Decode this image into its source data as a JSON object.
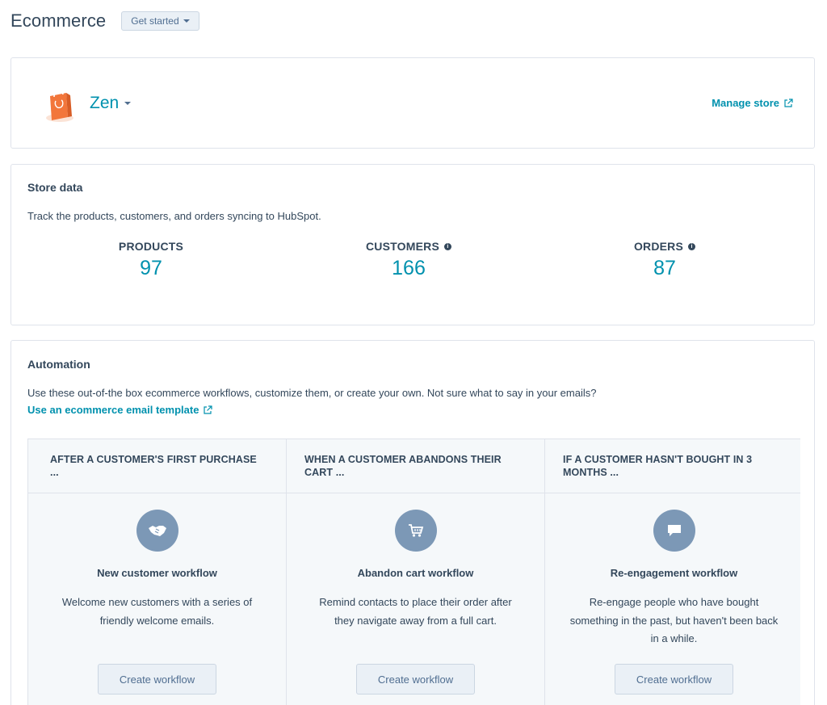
{
  "header": {
    "title": "Ecommerce",
    "get_started_label": "Get started"
  },
  "store": {
    "name": "Zen",
    "logo": "shopping-bag-logo",
    "manage_label": "Manage store"
  },
  "store_data": {
    "title": "Store data",
    "description": "Track the products, customers, and orders syncing to HubSpot.",
    "stats": [
      {
        "label": "PRODUCTS",
        "value": "97",
        "info": false
      },
      {
        "label": "CUSTOMERS",
        "value": "166",
        "info": true
      },
      {
        "label": "ORDERS",
        "value": "87",
        "info": true
      }
    ]
  },
  "automation": {
    "title": "Automation",
    "description": "Use these out-of-the box ecommerce workflows, customize them, or create your own. Not sure what to say in your emails?",
    "template_link": "Use an ecommerce email template",
    "workflows": [
      {
        "header": "AFTER A CUSTOMER'S FIRST PURCHASE ...",
        "icon": "handshake-icon",
        "name": "New customer workflow",
        "description": "Welcome new customers with a series of friendly welcome emails.",
        "button": "Create workflow"
      },
      {
        "header": "WHEN A CUSTOMER ABANDONS THEIR CART ...",
        "icon": "cart-icon",
        "name": "Abandon cart workflow",
        "description": "Remind contacts to place their order after they navigate away from a full cart.",
        "button": "Create workflow"
      },
      {
        "header": "IF A CUSTOMER HASN'T BOUGHT IN 3 MONTHS ...",
        "icon": "chat-bubble-icon",
        "name": "Re-engagement workflow",
        "description": "Re-engage people who have bought something in the past, but haven't been back in a while.",
        "button": "Create workflow"
      }
    ]
  },
  "colors": {
    "link": "#0091ae",
    "text": "#33475b",
    "icon_bg": "#7c98b6",
    "logo": "#f2763b"
  }
}
